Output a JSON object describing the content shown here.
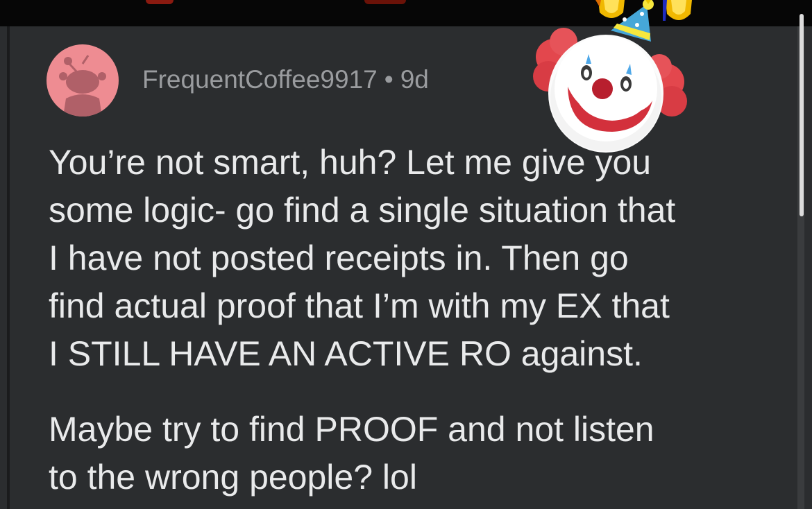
{
  "comment": {
    "username": "FrequentCoffee9917",
    "separator": "•",
    "age": "9d",
    "paragraphs": [
      {
        "lines": [
          "You’re not smart, huh? Let me give you",
          "some logic- go find a single situation that",
          "I have not posted receipts in. Then go",
          "find actual proof that I’m with my EX that",
          "I STILL HAVE AN ACTIVE RO against."
        ]
      },
      {
        "lines": [
          "Maybe try to find PROOF and not listen",
          "to the wrong people? lol"
        ]
      }
    ]
  },
  "stickers": {
    "clown": "clown-face-emoji",
    "party_hat": "party-hat-emoji",
    "flames": "fire-emoji"
  },
  "colors": {
    "background": "#2b2d2f",
    "text": "#e9eaeb",
    "meta_text": "#9a9c9f",
    "avatar_bg": "#ee8c92"
  }
}
